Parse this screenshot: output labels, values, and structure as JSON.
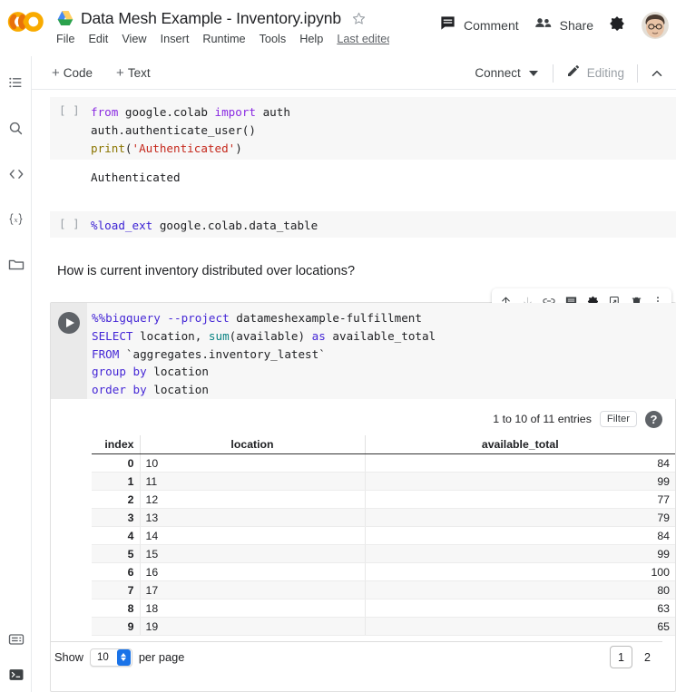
{
  "header": {
    "logo_name": "colab-logo",
    "drive_icon": "google-drive-icon",
    "doc_title": "Data Mesh Example - Inventory.ipynb",
    "star_icon": "star-outline-icon",
    "menus": [
      "File",
      "Edit",
      "View",
      "Insert",
      "Runtime",
      "Tools",
      "Help"
    ],
    "last_edited": "Last edited",
    "comment_label": "Comment",
    "comment_icon": "comment-icon",
    "share_label": "Share",
    "share_icon": "people-icon",
    "settings_icon": "gear-icon",
    "avatar_name": "user-avatar"
  },
  "toolbar": {
    "add_code_label": "Code",
    "add_text_label": "Text",
    "plus": "+",
    "connect_label": "Connect",
    "editing_label": "Editing",
    "pencil_icon": "pencil-icon",
    "chevron_up_icon": "chevron-up-icon"
  },
  "sidebar": {
    "items": [
      {
        "name": "table-of-contents-icon"
      },
      {
        "name": "search-icon"
      },
      {
        "name": "code-snippets-icon"
      },
      {
        "name": "variables-icon"
      },
      {
        "name": "files-icon"
      }
    ],
    "bottom_items": [
      {
        "name": "command-palette-icon"
      },
      {
        "name": "terminal-icon"
      }
    ]
  },
  "cells": [
    {
      "type": "code",
      "prompt": "[ ]",
      "lines": [
        [
          {
            "t": "from",
            "c": "k-purple"
          },
          {
            "t": " google.colab ",
            "c": ""
          },
          {
            "t": "import",
            "c": "k-purple"
          },
          {
            "t": " auth",
            "c": ""
          }
        ],
        [
          {
            "t": "auth.authenticate_user()",
            "c": ""
          }
        ],
        [
          {
            "t": "print",
            "c": "k-fn"
          },
          {
            "t": "(",
            "c": ""
          },
          {
            "t": "'Authenticated'",
            "c": "k-str"
          },
          {
            "t": ")",
            "c": ""
          }
        ]
      ],
      "output": "Authenticated"
    },
    {
      "type": "code",
      "prompt": "[ ]",
      "lines": [
        [
          {
            "t": "%load_ext",
            "c": "k-blue"
          },
          {
            "t": " google.colab.data_table",
            "c": ""
          }
        ]
      ]
    },
    {
      "type": "markdown",
      "text": "How is current inventory distributed over locations?"
    },
    {
      "type": "code-run",
      "run_icon": "run-cell-button",
      "lines": [
        [
          {
            "t": "%%bigquery",
            "c": "k-indigo"
          },
          {
            "t": " ",
            "c": ""
          },
          {
            "t": "--project",
            "c": "k-indigo"
          },
          {
            "t": " datameshexample-fulfillment",
            "c": ""
          }
        ],
        [
          {
            "t": "SELECT",
            "c": "k-indigo"
          },
          {
            "t": " location, ",
            "c": ""
          },
          {
            "t": "sum",
            "c": "k-teal"
          },
          {
            "t": "(available) ",
            "c": ""
          },
          {
            "t": "as",
            "c": "k-indigo"
          },
          {
            "t": " available_total",
            "c": ""
          }
        ],
        [
          {
            "t": "FROM",
            "c": "k-indigo"
          },
          {
            "t": " `aggregates.inventory_latest`",
            "c": ""
          }
        ],
        [
          {
            "t": "group",
            "c": "k-indigo"
          },
          {
            "t": " ",
            "c": ""
          },
          {
            "t": "by",
            "c": "k-indigo"
          },
          {
            "t": " location",
            "c": ""
          }
        ],
        [
          {
            "t": "order",
            "c": "k-indigo"
          },
          {
            "t": " ",
            "c": ""
          },
          {
            "t": "by",
            "c": "k-indigo"
          },
          {
            "t": " location",
            "c": ""
          }
        ]
      ]
    }
  ],
  "cell_toolbar": {
    "icons": [
      {
        "name": "move-cell-up-icon"
      },
      {
        "name": "move-cell-down-icon"
      },
      {
        "name": "link-to-cell-icon"
      },
      {
        "name": "add-comment-icon"
      },
      {
        "name": "cell-settings-icon"
      },
      {
        "name": "open-in-new-tab-icon"
      },
      {
        "name": "delete-cell-icon"
      },
      {
        "name": "more-options-icon"
      }
    ]
  },
  "data_table": {
    "entries_text": "1 to 10 of 11 entries",
    "filter_label": "Filter",
    "help_icon": "help-icon",
    "help_glyph": "?",
    "columns": [
      "index",
      "location",
      "available_total"
    ],
    "rows": [
      {
        "index": "0",
        "location": "10",
        "available_total": "84"
      },
      {
        "index": "1",
        "location": "11",
        "available_total": "99"
      },
      {
        "index": "2",
        "location": "12",
        "available_total": "77"
      },
      {
        "index": "3",
        "location": "13",
        "available_total": "79"
      },
      {
        "index": "4",
        "location": "14",
        "available_total": "84"
      },
      {
        "index": "5",
        "location": "15",
        "available_total": "99"
      },
      {
        "index": "6",
        "location": "16",
        "available_total": "100"
      },
      {
        "index": "7",
        "location": "17",
        "available_total": "80"
      },
      {
        "index": "8",
        "location": "18",
        "available_total": "63"
      },
      {
        "index": "9",
        "location": "19",
        "available_total": "65"
      }
    ],
    "footer": {
      "show_label": "Show",
      "per_page_value": "10",
      "per_page_label": "per page",
      "pages": [
        "1",
        "2"
      ],
      "active_page": "1"
    }
  },
  "colors": {
    "colab_orange": "#F9AB00",
    "drive_blue": "#1A73E8",
    "accent_blue": "#1a73e8",
    "code_bg": "#f7f7f7",
    "keyword_purple": "#8a2be2",
    "keyword_indigo": "#3c22d4",
    "string_red": "#c5281c",
    "func_olive": "#8b7500",
    "teal": "#0b8484"
  }
}
